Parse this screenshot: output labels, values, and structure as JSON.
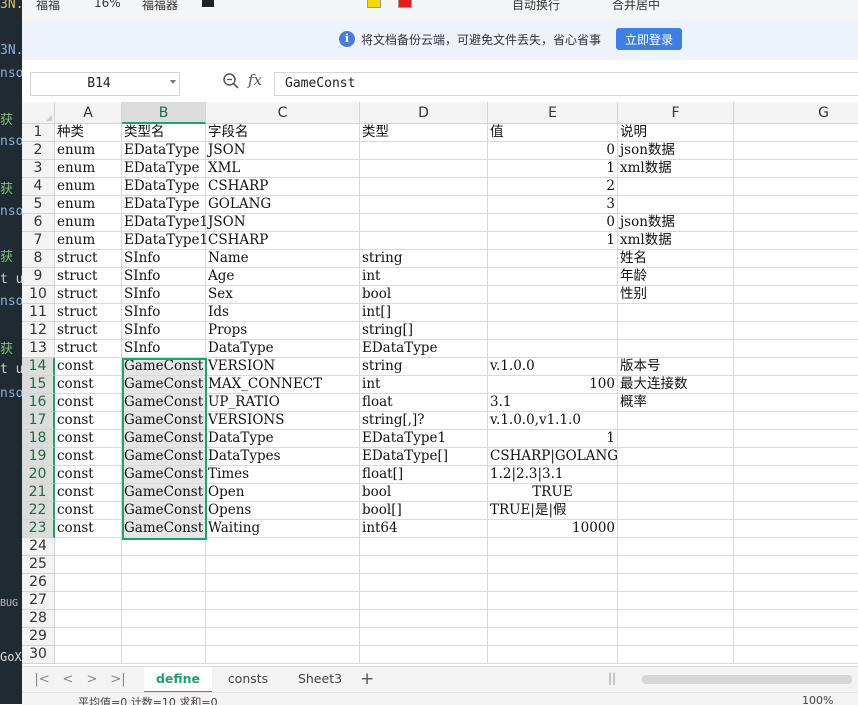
{
  "ide_fragments": [
    "3N.",
    "3N.",
    "nso",
    "获",
    "nso",
    "获",
    "nso",
    "获",
    "t u",
    "nso",
    "获",
    "t u",
    "nso",
    "BUG",
    "GoX"
  ],
  "ribbon_fragments": [
    "福福",
    "16%",
    "福福器",
    "替换",
    "查找",
    "自动换行",
    "合并居中"
  ],
  "notice": {
    "message": "将文档备份云端，可避免文件丢失，省心省事",
    "login_label": "立即登录",
    "accent": "#3f7fe4"
  },
  "formula_bar": {
    "cell_ref": "B14",
    "fx_label": "fx",
    "value": "GameConst"
  },
  "columns": [
    "A",
    "B",
    "C",
    "D",
    "E",
    "F",
    "G"
  ],
  "selected_column": "B",
  "selected_rows": [
    14,
    23
  ],
  "rows": [
    {
      "n": "1",
      "cells": [
        "种类",
        "类型名",
        "字段名",
        "类型",
        "值",
        "说明"
      ]
    },
    {
      "n": "2",
      "cells": [
        "enum",
        "EDataType",
        "JSON",
        "",
        "0",
        "json数据"
      ]
    },
    {
      "n": "3",
      "cells": [
        "enum",
        "EDataType",
        "XML",
        "",
        "1",
        "xml数据"
      ]
    },
    {
      "n": "4",
      "cells": [
        "enum",
        "EDataType",
        "CSHARP",
        "",
        "2",
        ""
      ]
    },
    {
      "n": "5",
      "cells": [
        "enum",
        "EDataType",
        "GOLANG",
        "",
        "3",
        ""
      ]
    },
    {
      "n": "6",
      "cells": [
        "enum",
        "EDataType1",
        "JSON",
        "",
        "0",
        "json数据"
      ]
    },
    {
      "n": "7",
      "cells": [
        "enum",
        "EDataType1",
        "CSHARP",
        "",
        "1",
        "xml数据"
      ]
    },
    {
      "n": "8",
      "cells": [
        "struct",
        "SInfo",
        "Name",
        "string",
        "",
        "姓名"
      ]
    },
    {
      "n": "9",
      "cells": [
        "struct",
        "SInfo",
        "Age",
        "int",
        "",
        "年龄"
      ]
    },
    {
      "n": "10",
      "cells": [
        "struct",
        "SInfo",
        "Sex",
        "bool",
        "",
        "性别"
      ]
    },
    {
      "n": "11",
      "cells": [
        "struct",
        "SInfo",
        "Ids",
        "int[]",
        "",
        ""
      ]
    },
    {
      "n": "12",
      "cells": [
        "struct",
        "SInfo",
        "Props",
        "string[]",
        "",
        ""
      ]
    },
    {
      "n": "13",
      "cells": [
        "struct",
        "SInfo",
        "DataType",
        "EDataType",
        "",
        ""
      ]
    },
    {
      "n": "14",
      "cells": [
        "const",
        "GameConst",
        "VERSION",
        "string",
        "v.1.0.0",
        "版本号"
      ]
    },
    {
      "n": "15",
      "cells": [
        "const",
        "GameConst",
        "MAX_CONNECT",
        "int",
        "100",
        "最大连接数"
      ]
    },
    {
      "n": "16",
      "cells": [
        "const",
        "GameConst",
        "UP_RATIO",
        "float",
        "3.1",
        "概率"
      ]
    },
    {
      "n": "17",
      "cells": [
        "const",
        "GameConst",
        "VERSIONS",
        "string[,]?",
        "v.1.0.0,v1.1.0",
        ""
      ]
    },
    {
      "n": "18",
      "cells": [
        "const",
        "GameConst",
        "DataType",
        "EDataType1",
        "1",
        ""
      ]
    },
    {
      "n": "19",
      "cells": [
        "const",
        "GameConst",
        "DataTypes",
        "EDataType[]",
        "CSHARP|GOLANG",
        ""
      ]
    },
    {
      "n": "20",
      "cells": [
        "const",
        "GameConst",
        "Times",
        "float[]",
        "1.2|2.3|3.1",
        ""
      ]
    },
    {
      "n": "21",
      "cells": [
        "const",
        "GameConst",
        "Open",
        "bool",
        "TRUE",
        ""
      ]
    },
    {
      "n": "22",
      "cells": [
        "const",
        "GameConst",
        "Opens",
        "bool[]",
        "TRUE|是|假",
        ""
      ]
    },
    {
      "n": "23",
      "cells": [
        "const",
        "GameConst",
        "Waiting",
        "int64",
        "10000",
        ""
      ]
    },
    {
      "n": "24",
      "cells": [
        "",
        "",
        "",
        "",
        "",
        ""
      ]
    },
    {
      "n": "25",
      "cells": [
        "",
        "",
        "",
        "",
        "",
        ""
      ]
    },
    {
      "n": "26",
      "cells": [
        "",
        "",
        "",
        "",
        "",
        ""
      ]
    },
    {
      "n": "27",
      "cells": [
        "",
        "",
        "",
        "",
        "",
        ""
      ]
    },
    {
      "n": "28",
      "cells": [
        "",
        "",
        "",
        "",
        "",
        ""
      ]
    },
    {
      "n": "29",
      "cells": [
        "",
        "",
        "",
        "",
        "",
        ""
      ]
    },
    {
      "n": "30",
      "cells": [
        "",
        "",
        "",
        "",
        "",
        ""
      ]
    }
  ],
  "sheet_tabs": [
    {
      "label": "define",
      "active": true
    },
    {
      "label": "consts",
      "active": false
    },
    {
      "label": "Sheet3",
      "active": false
    }
  ],
  "add_sheet_label": "+",
  "status": {
    "summary": "平均值=0  计数=10  求和=0",
    "zoom": "100%"
  }
}
